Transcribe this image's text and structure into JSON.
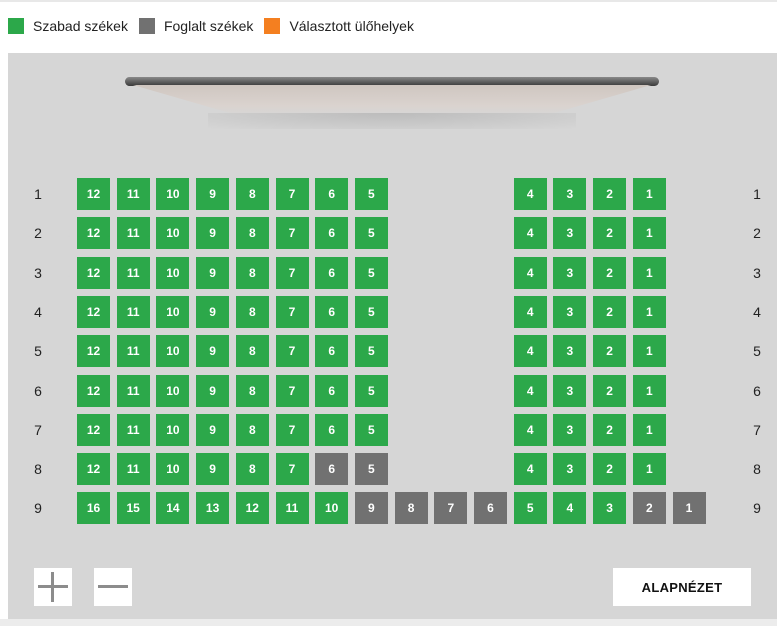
{
  "legend": [
    {
      "label": "Szabad székek",
      "color": "#2ca84a"
    },
    {
      "label": "Foglalt székek",
      "color": "#717171"
    },
    {
      "label": "Választott ülőhelyek",
      "color": "#f47f20"
    }
  ],
  "colors": {
    "free": "#2ca84a",
    "taken": "#717171",
    "selected": "#f47f20"
  },
  "rows": [
    {
      "label": "1",
      "seats": [
        {
          "num": "12",
          "status": "free"
        },
        {
          "num": "11",
          "status": "free"
        },
        {
          "num": "10",
          "status": "free"
        },
        {
          "num": "9",
          "status": "free"
        },
        {
          "num": "8",
          "status": "free"
        },
        {
          "num": "7",
          "status": "free"
        },
        {
          "num": "6",
          "status": "free"
        },
        {
          "num": "5",
          "status": "free"
        },
        null,
        null,
        null,
        {
          "num": "4",
          "status": "free"
        },
        {
          "num": "3",
          "status": "free"
        },
        {
          "num": "2",
          "status": "free"
        },
        {
          "num": "1",
          "status": "free"
        }
      ]
    },
    {
      "label": "2",
      "seats": [
        {
          "num": "12",
          "status": "free"
        },
        {
          "num": "11",
          "status": "free"
        },
        {
          "num": "10",
          "status": "free"
        },
        {
          "num": "9",
          "status": "free"
        },
        {
          "num": "8",
          "status": "free"
        },
        {
          "num": "7",
          "status": "free"
        },
        {
          "num": "6",
          "status": "free"
        },
        {
          "num": "5",
          "status": "free"
        },
        null,
        null,
        null,
        {
          "num": "4",
          "status": "free"
        },
        {
          "num": "3",
          "status": "free"
        },
        {
          "num": "2",
          "status": "free"
        },
        {
          "num": "1",
          "status": "free"
        }
      ]
    },
    {
      "label": "3",
      "seats": [
        {
          "num": "12",
          "status": "free"
        },
        {
          "num": "11",
          "status": "free"
        },
        {
          "num": "10",
          "status": "free"
        },
        {
          "num": "9",
          "status": "free"
        },
        {
          "num": "8",
          "status": "free"
        },
        {
          "num": "7",
          "status": "free"
        },
        {
          "num": "6",
          "status": "free"
        },
        {
          "num": "5",
          "status": "free"
        },
        null,
        null,
        null,
        {
          "num": "4",
          "status": "free"
        },
        {
          "num": "3",
          "status": "free"
        },
        {
          "num": "2",
          "status": "free"
        },
        {
          "num": "1",
          "status": "free"
        }
      ]
    },
    {
      "label": "4",
      "seats": [
        {
          "num": "12",
          "status": "free"
        },
        {
          "num": "11",
          "status": "free"
        },
        {
          "num": "10",
          "status": "free"
        },
        {
          "num": "9",
          "status": "free"
        },
        {
          "num": "8",
          "status": "free"
        },
        {
          "num": "7",
          "status": "free"
        },
        {
          "num": "6",
          "status": "free"
        },
        {
          "num": "5",
          "status": "free"
        },
        null,
        null,
        null,
        {
          "num": "4",
          "status": "free"
        },
        {
          "num": "3",
          "status": "free"
        },
        {
          "num": "2",
          "status": "free"
        },
        {
          "num": "1",
          "status": "free"
        }
      ]
    },
    {
      "label": "5",
      "seats": [
        {
          "num": "12",
          "status": "free"
        },
        {
          "num": "11",
          "status": "free"
        },
        {
          "num": "10",
          "status": "free"
        },
        {
          "num": "9",
          "status": "free"
        },
        {
          "num": "8",
          "status": "free"
        },
        {
          "num": "7",
          "status": "free"
        },
        {
          "num": "6",
          "status": "free"
        },
        {
          "num": "5",
          "status": "free"
        },
        null,
        null,
        null,
        {
          "num": "4",
          "status": "free"
        },
        {
          "num": "3",
          "status": "free"
        },
        {
          "num": "2",
          "status": "free"
        },
        {
          "num": "1",
          "status": "free"
        }
      ]
    },
    {
      "label": "6",
      "seats": [
        {
          "num": "12",
          "status": "free"
        },
        {
          "num": "11",
          "status": "free"
        },
        {
          "num": "10",
          "status": "free"
        },
        {
          "num": "9",
          "status": "free"
        },
        {
          "num": "8",
          "status": "free"
        },
        {
          "num": "7",
          "status": "free"
        },
        {
          "num": "6",
          "status": "free"
        },
        {
          "num": "5",
          "status": "free"
        },
        null,
        null,
        null,
        {
          "num": "4",
          "status": "free"
        },
        {
          "num": "3",
          "status": "free"
        },
        {
          "num": "2",
          "status": "free"
        },
        {
          "num": "1",
          "status": "free"
        }
      ]
    },
    {
      "label": "7",
      "seats": [
        {
          "num": "12",
          "status": "free"
        },
        {
          "num": "11",
          "status": "free"
        },
        {
          "num": "10",
          "status": "free"
        },
        {
          "num": "9",
          "status": "free"
        },
        {
          "num": "8",
          "status": "free"
        },
        {
          "num": "7",
          "status": "free"
        },
        {
          "num": "6",
          "status": "free"
        },
        {
          "num": "5",
          "status": "free"
        },
        null,
        null,
        null,
        {
          "num": "4",
          "status": "free"
        },
        {
          "num": "3",
          "status": "free"
        },
        {
          "num": "2",
          "status": "free"
        },
        {
          "num": "1",
          "status": "free"
        }
      ]
    },
    {
      "label": "8",
      "seats": [
        {
          "num": "12",
          "status": "free"
        },
        {
          "num": "11",
          "status": "free"
        },
        {
          "num": "10",
          "status": "free"
        },
        {
          "num": "9",
          "status": "free"
        },
        {
          "num": "8",
          "status": "free"
        },
        {
          "num": "7",
          "status": "free"
        },
        {
          "num": "6",
          "status": "taken"
        },
        {
          "num": "5",
          "status": "taken"
        },
        null,
        null,
        null,
        {
          "num": "4",
          "status": "free"
        },
        {
          "num": "3",
          "status": "free"
        },
        {
          "num": "2",
          "status": "free"
        },
        {
          "num": "1",
          "status": "free"
        }
      ]
    },
    {
      "label": "9",
      "seats": [
        {
          "num": "16",
          "status": "free"
        },
        {
          "num": "15",
          "status": "free"
        },
        {
          "num": "14",
          "status": "free"
        },
        {
          "num": "13",
          "status": "free"
        },
        {
          "num": "12",
          "status": "free"
        },
        {
          "num": "11",
          "status": "free"
        },
        {
          "num": "10",
          "status": "free"
        },
        {
          "num": "9",
          "status": "taken"
        },
        {
          "num": "8",
          "status": "taken"
        },
        {
          "num": "7",
          "status": "taken"
        },
        {
          "num": "6",
          "status": "taken"
        },
        {
          "num": "5",
          "status": "free"
        },
        {
          "num": "4",
          "status": "free"
        },
        {
          "num": "3",
          "status": "free"
        },
        {
          "num": "2",
          "status": "taken"
        },
        {
          "num": "1",
          "status": "taken"
        }
      ]
    }
  ],
  "controls": {
    "zoom_in_icon": "plus-icon",
    "zoom_out_icon": "minus-icon",
    "reset_label": "ALAPNÉZET"
  }
}
